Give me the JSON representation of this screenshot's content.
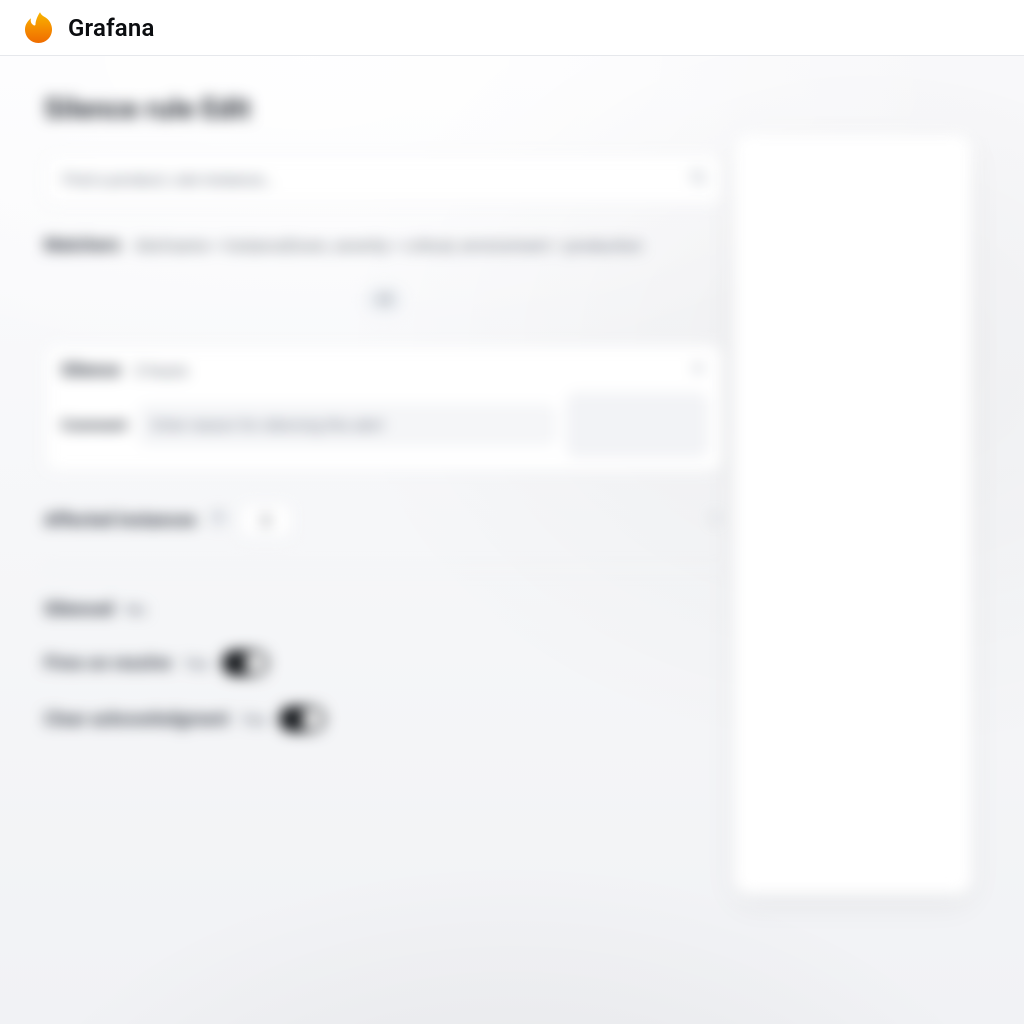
{
  "brand": {
    "name": "Grafana"
  },
  "page": {
    "title": "Silence rule Edit",
    "search_placeholder": "Find a product, rule instance…"
  },
  "matchers": {
    "header_label": "Matchers",
    "summary": "Alertname = InstanceDown, severity = critical, environment = production",
    "more_pill": "+2"
  },
  "silence_panel": {
    "label": "Silence",
    "value": "2 hours",
    "comment_label": "Comment",
    "comment_placeholder": "Enter reason for silencing this alert"
  },
  "instances": {
    "label": "Affected instances",
    "count": "3"
  },
  "silenced": {
    "label": "Silenced",
    "value": "No"
  },
  "rows": {
    "fires_on_resolve": {
      "label": "Fires on resolve",
      "value": "Yes"
    },
    "clear_acknowledgment": {
      "label": "Clear acknowledgment",
      "value": "Yes"
    }
  },
  "icons": {
    "search": "search-icon",
    "close": "close-icon",
    "help": "help-icon",
    "chevron": "chevron-right-icon"
  }
}
